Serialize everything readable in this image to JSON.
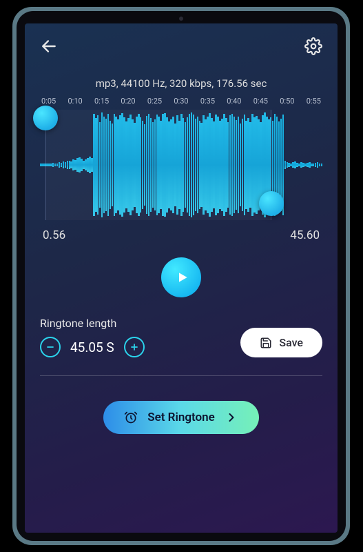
{
  "audio": {
    "info": "mp3, 44100 Hz, 320 kbps, 176.56 sec",
    "ticks": [
      "0:05",
      "0:10",
      "0:15",
      "0:20",
      "0:25",
      "0:30",
      "0:35",
      "0:40",
      "0:45",
      "0:50",
      "0:55"
    ]
  },
  "selection": {
    "start": "0.56",
    "end": "45.60",
    "start_frac": 0.02,
    "end_frac": 0.82
  },
  "ringtone": {
    "label": "Ringtone length",
    "value": "45.05 S"
  },
  "buttons": {
    "save": "Save",
    "set": "Set Ringtone"
  },
  "waveform_bars": [
    2,
    2,
    3,
    2,
    2,
    3,
    4,
    3,
    2,
    5,
    4,
    6,
    5,
    8,
    7,
    6,
    10,
    9,
    12,
    14,
    11,
    8,
    10,
    13,
    15,
    12,
    92,
    85,
    90,
    78,
    95,
    88,
    84,
    92,
    80,
    75,
    93,
    87,
    82,
    90,
    94,
    86,
    79,
    85,
    91,
    83,
    76,
    88,
    92,
    86,
    80,
    74,
    89,
    93,
    85,
    77,
    82,
    91,
    87,
    80,
    92,
    94,
    86,
    79,
    83,
    88,
    75,
    90,
    80,
    93,
    85,
    78,
    86,
    92,
    95,
    91,
    84,
    88,
    80,
    76,
    90,
    82,
    87,
    94,
    85,
    79,
    91,
    88,
    80,
    84,
    92,
    85,
    78,
    90,
    93,
    87,
    81,
    88,
    75,
    84,
    91,
    80,
    85,
    78,
    92,
    86,
    89,
    83,
    77,
    90,
    95,
    88,
    82,
    86,
    80,
    93,
    87,
    79,
    84,
    91,
    8,
    5,
    4,
    3,
    5,
    6,
    4,
    3,
    5,
    4,
    3,
    4,
    5,
    3,
    2,
    4,
    5,
    3,
    2
  ]
}
